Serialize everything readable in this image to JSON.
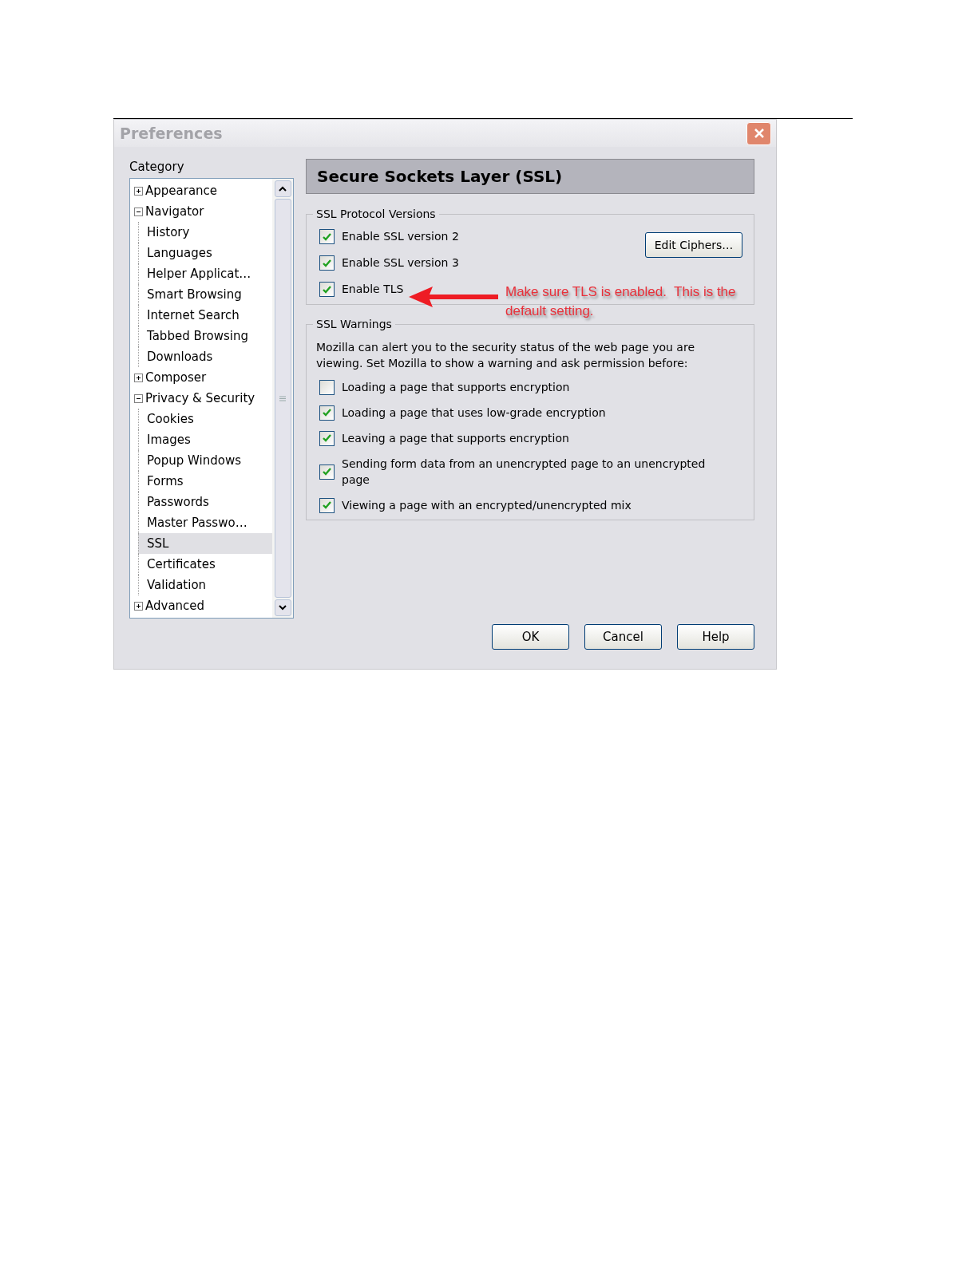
{
  "window": {
    "title": "Preferences"
  },
  "category": {
    "label": "Category",
    "items": [
      {
        "label": "Appearance",
        "expanded": false,
        "selected": false
      },
      {
        "label": "Navigator",
        "expanded": true,
        "selected": false,
        "children": [
          {
            "label": "History",
            "selected": false
          },
          {
            "label": "Languages",
            "selected": false
          },
          {
            "label": "Helper Applicat…",
            "selected": false
          },
          {
            "label": "Smart Browsing",
            "selected": false
          },
          {
            "label": "Internet Search",
            "selected": false
          },
          {
            "label": "Tabbed Browsing",
            "selected": false
          },
          {
            "label": "Downloads",
            "selected": false
          }
        ]
      },
      {
        "label": "Composer",
        "expanded": false,
        "selected": false
      },
      {
        "label": "Privacy & Security",
        "expanded": true,
        "selected": false,
        "children": [
          {
            "label": "Cookies",
            "selected": false
          },
          {
            "label": "Images",
            "selected": false
          },
          {
            "label": "Popup Windows",
            "selected": false
          },
          {
            "label": "Forms",
            "selected": false
          },
          {
            "label": "Passwords",
            "selected": false
          },
          {
            "label": "Master Passwo…",
            "selected": false
          },
          {
            "label": "SSL",
            "selected": true
          },
          {
            "label": "Certificates",
            "selected": false
          },
          {
            "label": "Validation",
            "selected": false
          }
        ]
      },
      {
        "label": "Advanced",
        "expanded": false,
        "selected": false
      }
    ]
  },
  "panel": {
    "title": "Secure Sockets Layer (SSL)",
    "protocol_group": {
      "legend": "SSL Protocol Versions",
      "options": [
        {
          "label": "Enable SSL version 2",
          "checked": true
        },
        {
          "label": "Enable SSL version 3",
          "checked": true
        },
        {
          "label": "Enable TLS",
          "checked": true
        }
      ],
      "button": "Edit Ciphers…"
    },
    "annotation": "Make sure TLS is enabled.  This is the default setting.",
    "warnings_group": {
      "legend": "SSL Warnings",
      "description": "Mozilla can alert you to the security status of the web page you are viewing. Set Mozilla to show a warning and ask permission before:",
      "options": [
        {
          "label": "Loading a page that supports encryption",
          "checked": false
        },
        {
          "label": "Loading a page that uses low-grade encryption",
          "checked": true
        },
        {
          "label": "Leaving a page that supports encryption",
          "checked": true
        },
        {
          "label": "Sending form data from an unencrypted page to an unencrypted page",
          "checked": true
        },
        {
          "label": "Viewing a page with an encrypted/unencrypted mix",
          "checked": true
        }
      ]
    }
  },
  "buttons": [
    "OK",
    "Cancel",
    "Help"
  ]
}
